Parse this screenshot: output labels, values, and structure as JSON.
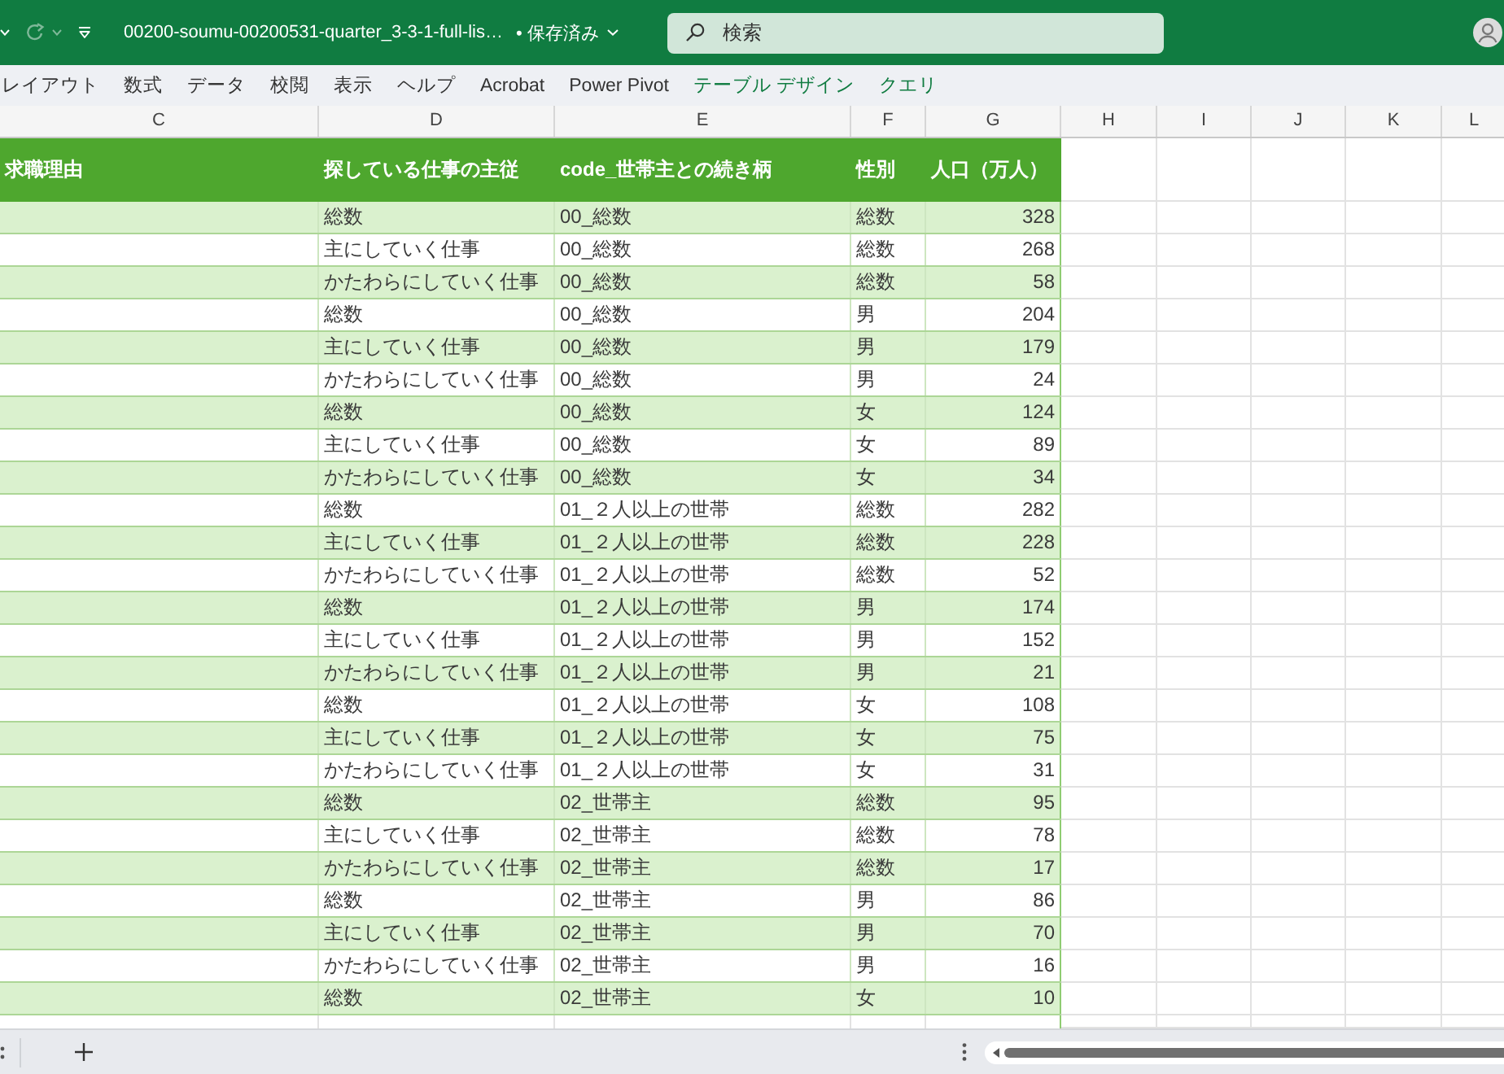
{
  "quick_access": {
    "redo": {
      "disabled": true
    }
  },
  "title_bar": {
    "file_name": "00200-soumu-00200531-quarter_3-3-1-full-lis…",
    "save_status": "• 保存済み",
    "search": {
      "placeholder": "検索"
    }
  },
  "ribbon_tabs": [
    {
      "label": "レイアウト",
      "kind": "standard"
    },
    {
      "label": "数式",
      "kind": "standard"
    },
    {
      "label": "データ",
      "kind": "standard"
    },
    {
      "label": "校閲",
      "kind": "standard"
    },
    {
      "label": "表示",
      "kind": "standard"
    },
    {
      "label": "ヘルプ",
      "kind": "standard"
    },
    {
      "label": "Acrobat",
      "kind": "standard"
    },
    {
      "label": "Power Pivot",
      "kind": "standard"
    },
    {
      "label": "テーブル デザイン",
      "kind": "contextual"
    },
    {
      "label": "クエリ",
      "kind": "contextual"
    }
  ],
  "column_letters": [
    "C",
    "D",
    "E",
    "F",
    "G",
    "H",
    "I",
    "J",
    "K",
    "L"
  ],
  "table": {
    "columns": [
      "求職理由",
      "探している仕事の主従",
      "code_世帯主との続き柄",
      "性別",
      "人口（万人）"
    ],
    "rows": [
      [
        "",
        "総数",
        "00_総数",
        "総数",
        "328"
      ],
      [
        "",
        "主にしていく仕事",
        "00_総数",
        "総数",
        "268"
      ],
      [
        "",
        "かたわらにしていく仕事",
        "00_総数",
        "総数",
        "58"
      ],
      [
        "",
        "総数",
        "00_総数",
        "男",
        "204"
      ],
      [
        "",
        "主にしていく仕事",
        "00_総数",
        "男",
        "179"
      ],
      [
        "",
        "かたわらにしていく仕事",
        "00_総数",
        "男",
        "24"
      ],
      [
        "",
        "総数",
        "00_総数",
        "女",
        "124"
      ],
      [
        "",
        "主にしていく仕事",
        "00_総数",
        "女",
        "89"
      ],
      [
        "",
        "かたわらにしていく仕事",
        "00_総数",
        "女",
        "34"
      ],
      [
        "",
        "総数",
        "01_２人以上の世帯",
        "総数",
        "282"
      ],
      [
        "",
        "主にしていく仕事",
        "01_２人以上の世帯",
        "総数",
        "228"
      ],
      [
        "",
        "かたわらにしていく仕事",
        "01_２人以上の世帯",
        "総数",
        "52"
      ],
      [
        "",
        "総数",
        "01_２人以上の世帯",
        "男",
        "174"
      ],
      [
        "",
        "主にしていく仕事",
        "01_２人以上の世帯",
        "男",
        "152"
      ],
      [
        "",
        "かたわらにしていく仕事",
        "01_２人以上の世帯",
        "男",
        "21"
      ],
      [
        "",
        "総数",
        "01_２人以上の世帯",
        "女",
        "108"
      ],
      [
        "",
        "主にしていく仕事",
        "01_２人以上の世帯",
        "女",
        "75"
      ],
      [
        "",
        "かたわらにしていく仕事",
        "01_２人以上の世帯",
        "女",
        "31"
      ],
      [
        "",
        "総数",
        "02_世帯主",
        "総数",
        "95"
      ],
      [
        "",
        "主にしていく仕事",
        "02_世帯主",
        "総数",
        "78"
      ],
      [
        "",
        "かたわらにしていく仕事",
        "02_世帯主",
        "総数",
        "17"
      ],
      [
        "",
        "総数",
        "02_世帯主",
        "男",
        "86"
      ],
      [
        "",
        "主にしていく仕事",
        "02_世帯主",
        "男",
        "70"
      ],
      [
        "",
        "かたわらにしていく仕事",
        "02_世帯主",
        "男",
        "16"
      ],
      [
        "",
        "総数",
        "02_世帯主",
        "女",
        "10"
      ]
    ]
  }
}
